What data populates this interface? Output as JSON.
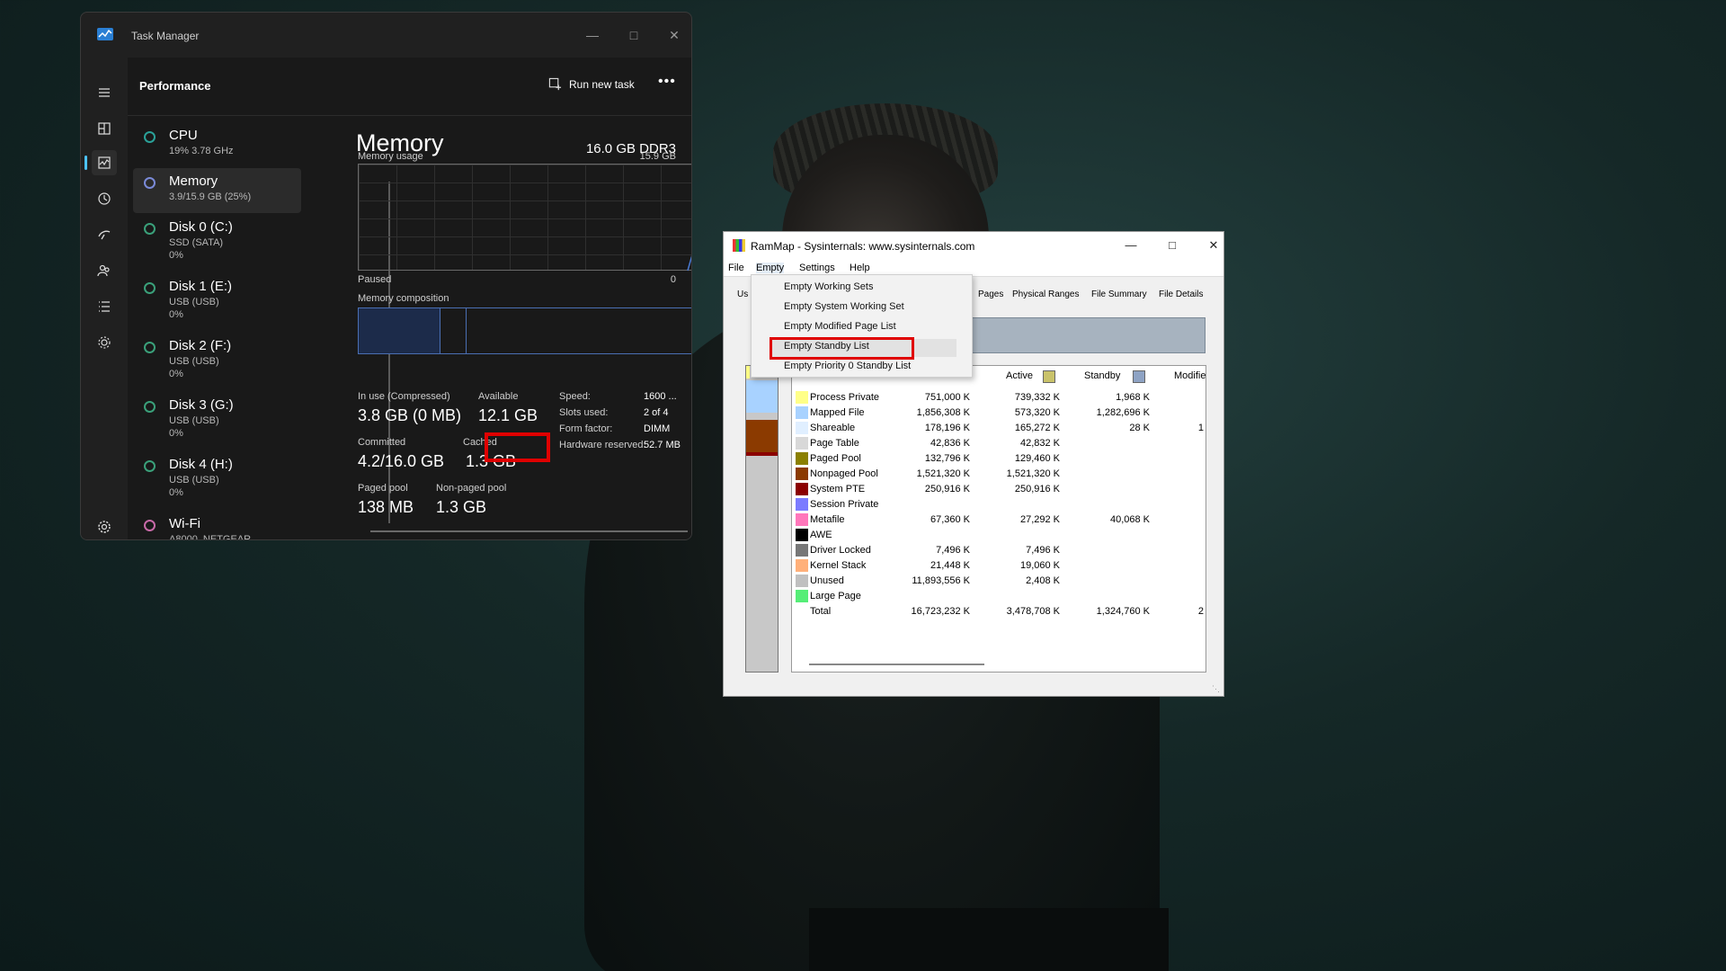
{
  "task_manager": {
    "title": "Task Manager",
    "page_title": "Performance",
    "run_new_task": "Run new task",
    "more": "•••",
    "sidebar": [
      {
        "name": "CPU",
        "sub": "19%  3.78 GHz",
        "sub2": "",
        "color": "#2aa198"
      },
      {
        "name": "Memory",
        "sub": "3.9/15.9 GB (25%)",
        "sub2": "",
        "color": "#7a8ad8"
      },
      {
        "name": "Disk 0 (C:)",
        "sub": "SSD (SATA)",
        "sub2": "0%",
        "color": "#3aa07a"
      },
      {
        "name": "Disk 1 (E:)",
        "sub": "USB (USB)",
        "sub2": "0%",
        "color": "#3aa07a"
      },
      {
        "name": "Disk 2 (F:)",
        "sub": "USB (USB)",
        "sub2": "0%",
        "color": "#3aa07a"
      },
      {
        "name": "Disk 3 (G:)",
        "sub": "USB (USB)",
        "sub2": "0%",
        "color": "#3aa07a"
      },
      {
        "name": "Disk 4 (H:)",
        "sub": "USB (USB)",
        "sub2": "0%",
        "color": "#3aa07a"
      },
      {
        "name": "Wi-Fi",
        "sub": "A8000_NETGEAR",
        "sub2": "",
        "color": "#c86aa8"
      }
    ],
    "memory": {
      "title": "Memory",
      "spec": "16.0 GB DDR3",
      "usage_label": "Memory usage",
      "usage_max": "15.9 GB",
      "paused": "Paused",
      "zero": "0",
      "composition_label": "Memory composition",
      "in_use_label": "In use (Compressed)",
      "in_use_value": "3.8 GB (0 MB)",
      "available_label": "Available",
      "available_value": "12.1 GB",
      "committed_label": "Committed",
      "committed_value": "4.2/16.0 GB",
      "cached_label": "Cached",
      "cached_value": "1.3 GB",
      "paged_pool_label": "Paged pool",
      "paged_pool_value": "138 MB",
      "nonpaged_pool_label": "Non-paged pool",
      "nonpaged_pool_value": "1.3 GB",
      "details": [
        {
          "k": "Speed:",
          "v": "1600 ..."
        },
        {
          "k": "Slots used:",
          "v": "2 of 4"
        },
        {
          "k": "Form factor:",
          "v": "DIMM"
        },
        {
          "k": "Hardware reserved:",
          "v": "52.7 MB"
        }
      ]
    }
  },
  "rammap": {
    "title": "RamMap - Sysinternals: www.sysinternals.com",
    "menus": [
      "File",
      "Empty",
      "Settings",
      "Help"
    ],
    "tabs_visible": [
      "Us",
      "Pages",
      "Physical Ranges",
      "File Summary",
      "File Details"
    ],
    "columns": {
      "active": "Active",
      "standby": "Standby",
      "modified": "Modifie"
    },
    "active_color": "#c9c26a",
    "standby_color": "#8ea3c4",
    "rows": [
      {
        "name": "Process Private",
        "color": "#ffff88",
        "total": "751,000 K",
        "active": "739,332 K",
        "standby": "1,968 K",
        "extra": ""
      },
      {
        "name": "Mapped File",
        "color": "#a8d2ff",
        "total": "1,856,308 K",
        "active": "573,320 K",
        "standby": "1,282,696 K",
        "extra": ""
      },
      {
        "name": "Shareable",
        "color": "#e0efff",
        "total": "178,196 K",
        "active": "165,272 K",
        "standby": "28 K",
        "extra": "1"
      },
      {
        "name": "Page Table",
        "color": "#d8d8d8",
        "total": "42,836 K",
        "active": "42,832 K",
        "standby": "",
        "extra": ""
      },
      {
        "name": "Paged Pool",
        "color": "#8b8000",
        "total": "132,796 K",
        "active": "129,460 K",
        "standby": "",
        "extra": ""
      },
      {
        "name": "Nonpaged Pool",
        "color": "#8b3a00",
        "total": "1,521,320 K",
        "active": "1,521,320 K",
        "standby": "",
        "extra": ""
      },
      {
        "name": "System PTE",
        "color": "#8b0000",
        "total": "250,916 K",
        "active": "250,916 K",
        "standby": "",
        "extra": ""
      },
      {
        "name": "Session Private",
        "color": "#7b7bff",
        "total": "",
        "active": "",
        "standby": "",
        "extra": ""
      },
      {
        "name": "Metafile",
        "color": "#ff77bb",
        "total": "67,360 K",
        "active": "27,292 K",
        "standby": "40,068 K",
        "extra": ""
      },
      {
        "name": "AWE",
        "color": "#000000",
        "total": "",
        "active": "",
        "standby": "",
        "extra": ""
      },
      {
        "name": "Driver Locked",
        "color": "#777777",
        "total": "7,496 K",
        "active": "7,496 K",
        "standby": "",
        "extra": ""
      },
      {
        "name": "Kernel Stack",
        "color": "#ffb07a",
        "total": "21,448 K",
        "active": "19,060 K",
        "standby": "",
        "extra": ""
      },
      {
        "name": "Unused",
        "color": "#c0c0c0",
        "total": "11,893,556 K",
        "active": "2,408 K",
        "standby": "",
        "extra": ""
      },
      {
        "name": "Large Page",
        "color": "#55ee77",
        "total": "",
        "active": "",
        "standby": "",
        "extra": ""
      },
      {
        "name": "Total",
        "color": "",
        "total": "16,723,232 K",
        "active": "3,478,708 K",
        "standby": "1,324,760 K",
        "extra": "2"
      }
    ],
    "empty_menu": [
      "Empty Working Sets",
      "Empty System Working Set",
      "Empty Modified Page List",
      "Empty Standby List",
      "Empty Priority 0 Standby List"
    ]
  }
}
